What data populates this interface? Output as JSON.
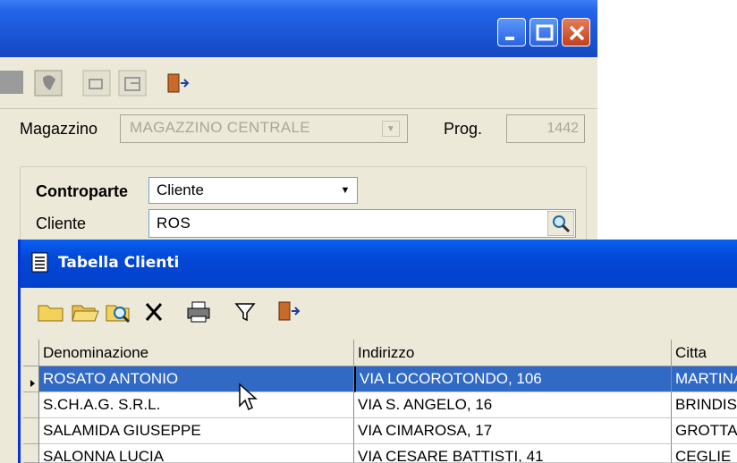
{
  "background_window": {
    "title_buttons": [
      "minimize",
      "maximize",
      "close"
    ],
    "toolbar_icons": [
      "blank-icon",
      "globe-icon",
      "enter-icon",
      "exit-record-icon",
      "exit-door-icon"
    ],
    "form": {
      "magazzino_label": "Magazzino",
      "magazzino_value": "MAGAZZINO CENTRALE",
      "prog_label": "Prog.",
      "prog_value": "1442",
      "controparte_label": "Controparte",
      "controparte_value": "Cliente",
      "cliente_label": "Cliente",
      "cliente_value": "ROS"
    }
  },
  "dialog": {
    "title": "Tabella Clienti",
    "toolbar_icons": [
      "folder-new-icon",
      "folder-open-icon",
      "search-folder-icon",
      "delete-icon",
      "print-icon",
      "filter-icon",
      "exit-door-icon"
    ],
    "table": {
      "columns": [
        "Denominazione",
        "Indirizzo",
        "Citta"
      ],
      "rows": [
        [
          "ROSATO ANTONIO",
          "VIA LOCOROTONDO, 106",
          "MARTINA"
        ],
        [
          "S.CH.A.G.  S.R.L.",
          "VIA S. ANGELO, 16",
          "BRINDISI"
        ],
        [
          "SALAMIDA GIUSEPPE",
          "VIA CIMAROSA, 17",
          "GROTTAGLIE"
        ],
        [
          "SALONNA LUCIA",
          "VIA CESARE BATTISTI, 41",
          "CEGLIE"
        ]
      ],
      "selected_row": 0
    }
  },
  "colors": {
    "xp_blue": "#0347d6",
    "selection": "#316ac5",
    "face": "#ece9d8"
  }
}
